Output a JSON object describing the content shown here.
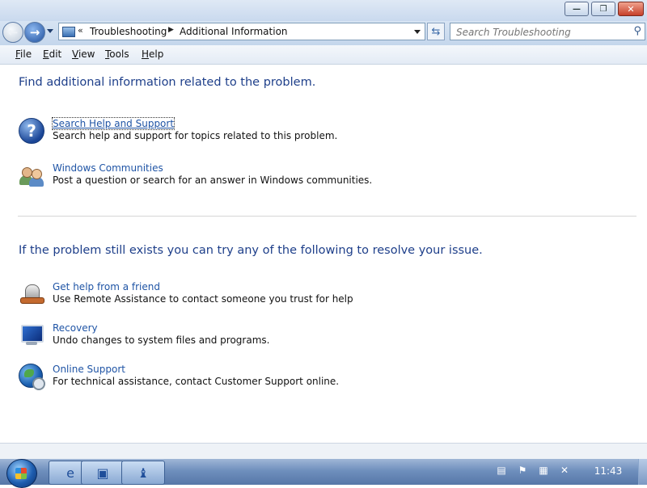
{
  "window": {
    "minimize_glyph": "—",
    "restore_glyph": "❐",
    "close_glyph": "✕"
  },
  "nav": {
    "back_glyph": "←",
    "forward_glyph": "→",
    "breadcrumb_chevron": "«",
    "breadcrumb": [
      "Troubleshooting",
      "Additional Information"
    ],
    "breadcrumb_separator": "▶",
    "refresh_glyph": "⇆",
    "search_placeholder": "Search Troubleshooting",
    "search_glyph": "⚲"
  },
  "menu": {
    "items": [
      {
        "label": "File",
        "accel": "F",
        "rest": "ile"
      },
      {
        "label": "Edit",
        "accel": "E",
        "rest": "dit"
      },
      {
        "label": "View",
        "accel": "V",
        "rest": "iew"
      },
      {
        "label": "Tools",
        "accel": "T",
        "rest": "ools"
      },
      {
        "label": "Help",
        "accel": "H",
        "rest": "elp"
      }
    ]
  },
  "content": {
    "section1_heading": "Find additional information related to the problem.",
    "section1_items": [
      {
        "icon": "help-icon",
        "link": "Search Help and Support",
        "desc": "Search help and support for topics related to this problem."
      },
      {
        "icon": "people-icon",
        "link": "Windows Communities",
        "desc": "Post a question or search for an answer in Windows communities."
      }
    ],
    "section2_heading": "If the problem still exists you can try any of the following to resolve your issue.",
    "section2_items": [
      {
        "icon": "remote-assistance-icon",
        "link": "Get help from a friend",
        "desc": "Use Remote Assistance to contact someone you trust for help"
      },
      {
        "icon": "recovery-icon",
        "link": "Recovery",
        "desc": "Undo changes to system files and programs."
      },
      {
        "icon": "globe-icon",
        "link": "Online Support",
        "desc": "For technical assistance, contact Customer Support online."
      }
    ],
    "help_glyph": "?"
  },
  "taskbar": {
    "pinned": [
      {
        "icon": "internet-explorer-icon",
        "glyph": "e"
      },
      {
        "icon": "control-panel-icon",
        "glyph": "▣"
      },
      {
        "icon": "troubleshooting-icon",
        "glyph": "♝"
      }
    ],
    "tray": [
      {
        "icon": "notes-icon",
        "glyph": "▤"
      },
      {
        "icon": "action-center-icon",
        "glyph": "⚑"
      },
      {
        "icon": "network-icon",
        "glyph": "▦"
      },
      {
        "icon": "volume-muted-icon",
        "glyph": "✕"
      }
    ],
    "clock": "11:43"
  },
  "colors": {
    "heading": "#1e3f8a",
    "link": "#1f54a5",
    "taskbar": "#6f8fbd"
  }
}
